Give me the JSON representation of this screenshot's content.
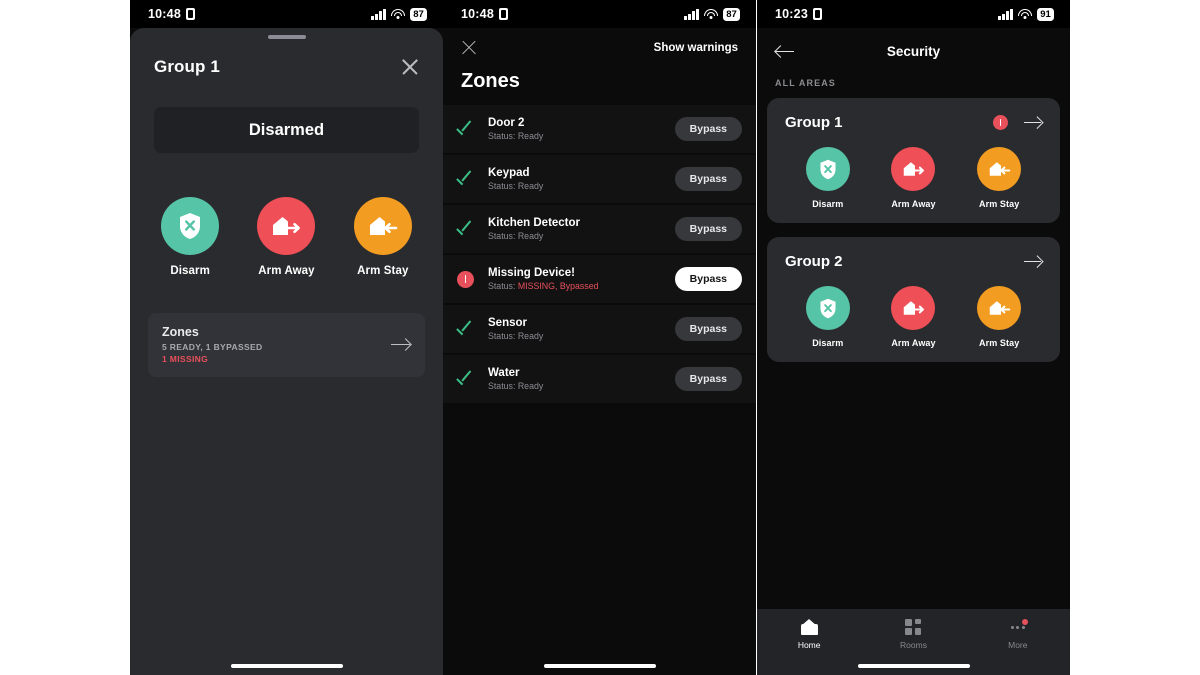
{
  "colors": {
    "disarm": "#56c4a7",
    "arm_away": "#ef4f56",
    "arm_stay": "#f29c22",
    "alert_red": "#e8505b",
    "check_green": "#3bbf86",
    "sheet_bg": "#2a2b2e",
    "page_bg": "#0b0b0b"
  },
  "panel_group": {
    "statusbar": {
      "time": "10:48",
      "battery": "87"
    },
    "title": "Group 1",
    "close_label": "×",
    "state": "Disarmed",
    "modes": [
      {
        "label": "Disarm",
        "icon": "shield-x-icon"
      },
      {
        "label": "Arm Away",
        "icon": "house-arrow-right-icon"
      },
      {
        "label": "Arm Stay",
        "icon": "house-arrow-left-icon"
      }
    ],
    "zones_card": {
      "title": "Zones",
      "summary": "5 READY, 1 BYPASSED",
      "missing": "1 MISSING"
    }
  },
  "panel_zones": {
    "statusbar": {
      "time": "10:48",
      "battery": "87"
    },
    "show_warnings": "Show warnings",
    "title": "Zones",
    "rows": [
      {
        "name": "Door 2",
        "status_prefix": "Status: ",
        "status": "Ready",
        "state": "ok",
        "bypass_label": "Bypass",
        "bypass_active": false
      },
      {
        "name": "Keypad",
        "status_prefix": "Status: ",
        "status": "Ready",
        "state": "ok",
        "bypass_label": "Bypass",
        "bypass_active": false
      },
      {
        "name": "Kitchen Detector",
        "status_prefix": "Status: ",
        "status": "Ready",
        "state": "ok",
        "bypass_label": "Bypass",
        "bypass_active": false
      },
      {
        "name": "Missing Device!",
        "status_prefix": "Status: ",
        "status": "MISSING, Bypassed",
        "state": "alert",
        "bypass_label": "Bypass",
        "bypass_active": true
      },
      {
        "name": "Sensor",
        "status_prefix": "Status: ",
        "status": "Ready",
        "state": "ok",
        "bypass_label": "Bypass",
        "bypass_active": false
      },
      {
        "name": "Water",
        "status_prefix": "Status: ",
        "status": "Ready",
        "state": "ok",
        "bypass_label": "Bypass",
        "bypass_active": false
      }
    ]
  },
  "panel_security": {
    "statusbar": {
      "time": "10:23",
      "battery": "91"
    },
    "nav_title": "Security",
    "section_label": "ALL AREAS",
    "groups": [
      {
        "title": "Group 1",
        "has_alert": true,
        "modes": [
          {
            "label": "Disarm",
            "icon": "shield-x-icon"
          },
          {
            "label": "Arm Away",
            "icon": "house-arrow-right-icon"
          },
          {
            "label": "Arm Stay",
            "icon": "house-arrow-left-icon"
          }
        ]
      },
      {
        "title": "Group 2",
        "has_alert": false,
        "modes": [
          {
            "label": "Disarm",
            "icon": "shield-x-icon"
          },
          {
            "label": "Arm Away",
            "icon": "house-arrow-right-icon"
          },
          {
            "label": "Arm Stay",
            "icon": "house-arrow-left-icon"
          }
        ]
      }
    ],
    "tabs": [
      {
        "label": "Home",
        "icon": "home-icon",
        "active": true,
        "badge": false
      },
      {
        "label": "Rooms",
        "icon": "grid-icon",
        "active": false,
        "badge": false
      },
      {
        "label": "More",
        "icon": "ellipsis-icon",
        "active": false,
        "badge": true
      }
    ]
  }
}
